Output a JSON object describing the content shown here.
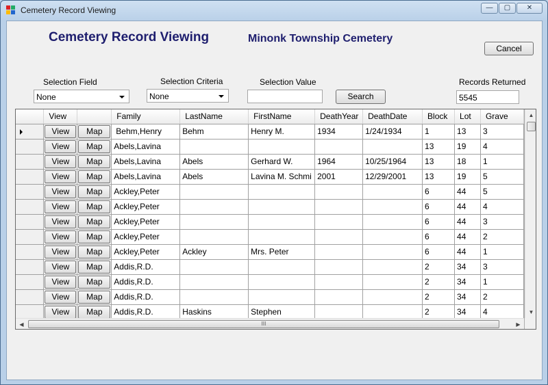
{
  "window": {
    "title": "Cemetery Record Viewing",
    "controls": {
      "minimize": "—",
      "maximize": "▢",
      "close": "✕"
    }
  },
  "header": {
    "app_title": "Cemetery Record Viewing",
    "cemetery_name": "Minonk Township Cemetery",
    "cancel_label": "Cancel"
  },
  "filters": {
    "selection_field": {
      "label": "Selection Field",
      "value": "None"
    },
    "selection_criteria": {
      "label": "Selection Criteria",
      "value": "None"
    },
    "selection_value": {
      "label": "Selection Value",
      "value": ""
    },
    "search_label": "Search",
    "records_returned": {
      "label": "Records Returned",
      "value": "5545"
    }
  },
  "grid": {
    "columns": [
      "View",
      "",
      "Family",
      "LastName",
      "FirstName",
      "DeathYear",
      "DeathDate",
      "Block",
      "Lot",
      "Grave"
    ],
    "view_button_label": "View",
    "map_button_label": "Map",
    "rows": [
      {
        "family": "Behm,Henry",
        "last": "Behm",
        "first": "Henry M.",
        "year": "1934",
        "date": "1/24/1934",
        "block": "1",
        "lot": "13",
        "grave": "3"
      },
      {
        "family": "Abels,Lavina",
        "last": "",
        "first": "",
        "year": "",
        "date": "",
        "block": "13",
        "lot": "19",
        "grave": "4"
      },
      {
        "family": "Abels,Lavina",
        "last": "Abels",
        "first": "Gerhard W.",
        "year": "1964",
        "date": "10/25/1964",
        "block": "13",
        "lot": "18",
        "grave": "1"
      },
      {
        "family": "Abels,Lavina",
        "last": "Abels",
        "first": "Lavina M. Schmi",
        "year": "2001",
        "date": "12/29/2001",
        "block": "13",
        "lot": "19",
        "grave": "5"
      },
      {
        "family": "Ackley,Peter",
        "last": "",
        "first": "",
        "year": "",
        "date": "",
        "block": "6",
        "lot": "44",
        "grave": "5"
      },
      {
        "family": "Ackley,Peter",
        "last": "",
        "first": "",
        "year": "",
        "date": "",
        "block": "6",
        "lot": "44",
        "grave": "4"
      },
      {
        "family": "Ackley,Peter",
        "last": "",
        "first": "",
        "year": "",
        "date": "",
        "block": "6",
        "lot": "44",
        "grave": "3"
      },
      {
        "family": "Ackley,Peter",
        "last": "",
        "first": "",
        "year": "",
        "date": "",
        "block": "6",
        "lot": "44",
        "grave": "2"
      },
      {
        "family": "Ackley,Peter",
        "last": "Ackley",
        "first": "Mrs. Peter",
        "year": "",
        "date": "",
        "block": "6",
        "lot": "44",
        "grave": "1"
      },
      {
        "family": "Addis,R.D.",
        "last": "",
        "first": "",
        "year": "",
        "date": "",
        "block": "2",
        "lot": "34",
        "grave": "3"
      },
      {
        "family": "Addis,R.D.",
        "last": "",
        "first": "",
        "year": "",
        "date": "",
        "block": "2",
        "lot": "34",
        "grave": "1"
      },
      {
        "family": "Addis,R.D.",
        "last": "",
        "first": "",
        "year": "",
        "date": "",
        "block": "2",
        "lot": "34",
        "grave": "2"
      },
      {
        "family": "Addis,R.D.",
        "last": "Haskins",
        "first": "Stephen",
        "year": "",
        "date": "",
        "block": "2",
        "lot": "34",
        "grave": "4"
      }
    ],
    "hscroll_grip": "III"
  }
}
